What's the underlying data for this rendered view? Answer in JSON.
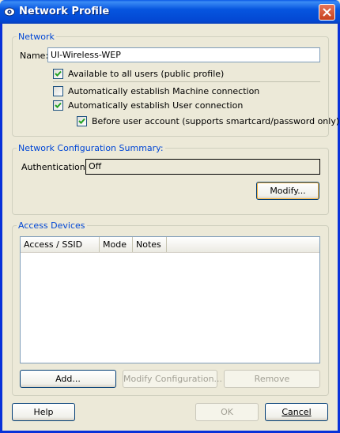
{
  "window": {
    "title": "Network Profile"
  },
  "network": {
    "group_label": "Network",
    "name_label": "Name:",
    "name_value": "UI-Wireless-WEP",
    "public_profile": {
      "label": "Available to all users (public profile)",
      "checked": true
    },
    "machine_conn": {
      "label": "Automatically establish Machine connection",
      "checked": false
    },
    "user_conn": {
      "label": "Automatically establish User connection",
      "checked": true
    },
    "before_user": {
      "label": "Before user account (supports smartcard/password only)",
      "checked": true
    }
  },
  "config_summary": {
    "group_label": "Network Configuration Summary:",
    "auth_label": "Authentication:",
    "auth_value": "Off",
    "modify_button": "Modify..."
  },
  "access_devices": {
    "group_label": "Access Devices",
    "columns": [
      "Access / SSID",
      "Mode",
      "Notes"
    ],
    "rows": [],
    "add_button": "Add...",
    "modify_config_button": "Modify Configuration...",
    "remove_button": "Remove"
  },
  "footer": {
    "help_button": "Help",
    "ok_button": "OK",
    "cancel_button": "Cancel"
  },
  "colors": {
    "title_bar": "#0655df",
    "group_label": "#0046d5",
    "dialog_bg": "#ece9d8"
  },
  "icons": {
    "title": "network-profile-icon",
    "close": "close-icon",
    "check": "check-icon"
  }
}
